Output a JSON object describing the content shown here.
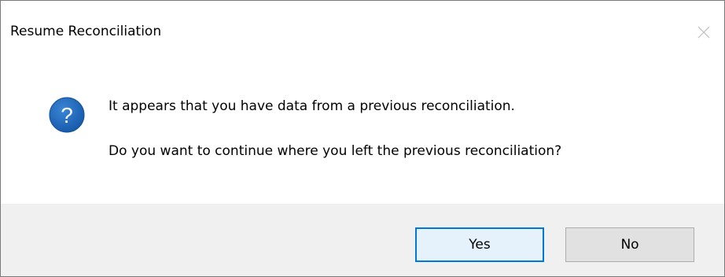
{
  "window": {
    "title": "Resume Reconciliation"
  },
  "icons": {
    "close": "close-icon",
    "question": "question-icon"
  },
  "message": {
    "line1": "It appears that you have data from a previous reconciliation.",
    "line2": "Do you want to continue where you left the previous reconciliation?"
  },
  "buttons": {
    "yes_label": "Yes",
    "no_label": "No"
  },
  "colors": {
    "question_icon": "#1a63b8",
    "default_button_border": "#0078d7",
    "footer_background": "#f0f0f0"
  }
}
